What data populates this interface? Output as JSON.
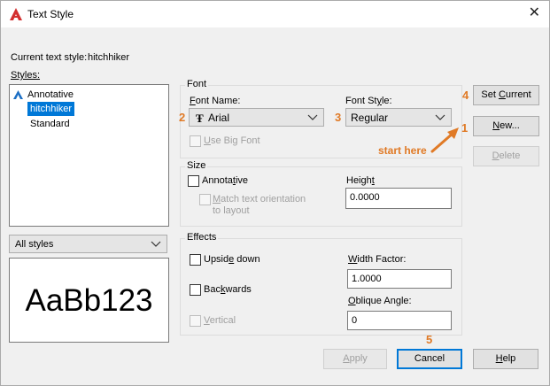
{
  "window": {
    "title": "Text Style",
    "close_glyph": "✕"
  },
  "current_style": {
    "label": "Current text style:",
    "value": "hitchhiker"
  },
  "styles": {
    "label": "Styles:",
    "items": [
      {
        "label": "Annotative",
        "icon": "annotative-icon"
      },
      {
        "label": "hitchhiker",
        "selected": true
      },
      {
        "label": "Standard"
      }
    ],
    "filter": "All styles"
  },
  "preview": {
    "text": "AaBb123"
  },
  "font": {
    "group_label": "Font",
    "name_label": "Font Name:",
    "name_value": "Arial",
    "font_icon_glyph": "Ŧ",
    "style_label": "Font Style:",
    "style_value": "Regular",
    "big_font_label": "Use Big Font"
  },
  "size": {
    "group_label": "Size",
    "annotative_label": "Annotative",
    "match_label_1": "Match text orientation",
    "match_label_2": "to layout",
    "height_label": "Height",
    "height_value": "0.0000"
  },
  "effects": {
    "group_label": "Effects",
    "upside_down_label": "Upside down",
    "backwards_label": "Backwards",
    "vertical_label": "Vertical",
    "width_label": "Width Factor:",
    "width_value": "1.0000",
    "oblique_label": "Oblique Angle:",
    "oblique_value": "0"
  },
  "buttons": {
    "set_current": "Set Current",
    "new": "New...",
    "delete": "Delete",
    "apply": "Apply",
    "cancel": "Cancel",
    "help": "Help"
  },
  "annotations": {
    "n1": "1",
    "n2": "2",
    "n3": "3",
    "n4": "4",
    "n5": "5",
    "start_here": "start here",
    "color": "#e07a26"
  },
  "colors": {
    "selection": "#0078d7",
    "app_icon": "#d32f2f"
  }
}
